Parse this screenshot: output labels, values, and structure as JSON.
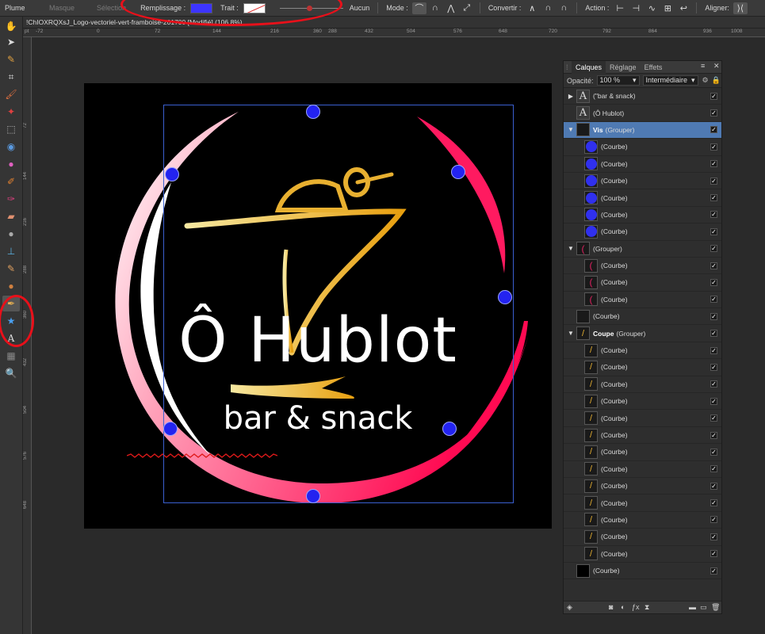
{
  "toolbar": {
    "tool_name": "Plume",
    "mask_label": "Masque",
    "selection_label": "Sélection",
    "fill_label": "Remplissage :",
    "fill_color": "#3d35ff",
    "stroke_label": "Trait :",
    "stroke_width_value": "Aucun",
    "mode_label": "Mode :",
    "convert_label": "Convertir :",
    "action_label": "Action :",
    "align_label": "Aligner:"
  },
  "document": {
    "tab_title": "!ChIOXRQXsJ_Logo-vectoriel-vert-framboise-201700 [Modifié] (106.8%)"
  },
  "ruler_top": [
    "-72",
    "0",
    "72",
    "144",
    "216",
    "288",
    "360",
    "432",
    "504",
    "576",
    "648",
    "720",
    "792",
    "864",
    "936",
    "1008"
  ],
  "ruler_left": [
    "72",
    "144",
    "216",
    "288",
    "360",
    "432",
    "504",
    "576",
    "648"
  ],
  "ruler_unit": "pt",
  "artwork": {
    "title": "Ô Hublot",
    "subtitle": "bar & snack"
  },
  "layers_panel": {
    "tabs": [
      "Calques",
      "Réglage",
      "Effets"
    ],
    "opacity_label": "Opacité:",
    "opacity_value": "100 %",
    "blend_mode": "Intermédiaire",
    "rows": [
      {
        "name": "(\"bar & snack)",
        "type": "text",
        "expand": "▶"
      },
      {
        "name": "(Ô Hublot)",
        "type": "text",
        "expand": ""
      },
      {
        "name": "Vis",
        "suffix": "(Grouper)",
        "type": "group",
        "expand": "▼",
        "selected": true
      },
      {
        "name": "(Courbe)",
        "type": "dot",
        "indent": true
      },
      {
        "name": "(Courbe)",
        "type": "dot",
        "indent": true
      },
      {
        "name": "(Courbe)",
        "type": "dot",
        "indent": true
      },
      {
        "name": "(Courbe)",
        "type": "dot",
        "indent": true
      },
      {
        "name": "(Courbe)",
        "type": "dot",
        "indent": true
      },
      {
        "name": "(Courbe)",
        "type": "dot",
        "indent": true
      },
      {
        "name": "(Grouper)",
        "type": "ring",
        "expand": "▼"
      },
      {
        "name": "(Courbe)",
        "type": "arc",
        "indent": true
      },
      {
        "name": "(Courbe)",
        "type": "arc",
        "indent": true
      },
      {
        "name": "(Courbe)",
        "type": "arc",
        "indent": true
      },
      {
        "name": "(Courbe)",
        "type": "blank"
      },
      {
        "name": "Coupe",
        "suffix": "(Grouper)",
        "type": "glass",
        "expand": "▼"
      },
      {
        "name": "(Courbe)",
        "type": "gold",
        "indent": true
      },
      {
        "name": "(Courbe)",
        "type": "gold",
        "indent": true
      },
      {
        "name": "(Courbe)",
        "type": "gold",
        "indent": true
      },
      {
        "name": "(Courbe)",
        "type": "gold",
        "indent": true
      },
      {
        "name": "(Courbe)",
        "type": "gold",
        "indent": true
      },
      {
        "name": "(Courbe)",
        "type": "gold",
        "indent": true
      },
      {
        "name": "(Courbe)",
        "type": "gold",
        "indent": true
      },
      {
        "name": "(Courbe)",
        "type": "gold",
        "indent": true
      },
      {
        "name": "(Courbe)",
        "type": "gold",
        "indent": true
      },
      {
        "name": "(Courbe)",
        "type": "gold",
        "indent": true
      },
      {
        "name": "(Courbe)",
        "type": "gold",
        "indent": true
      },
      {
        "name": "(Courbe)",
        "type": "gold",
        "indent": true
      },
      {
        "name": "(Courbe)",
        "type": "gold",
        "indent": true
      },
      {
        "name": "(Courbe)",
        "type": "black"
      }
    ]
  }
}
